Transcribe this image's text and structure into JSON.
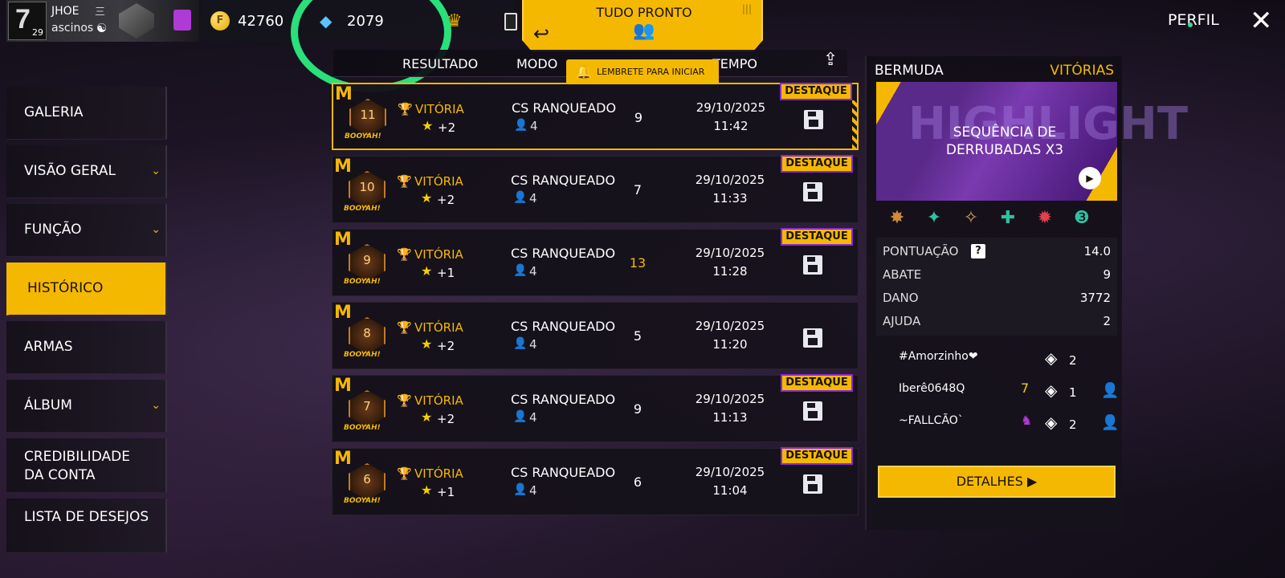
{
  "player": {
    "name": "JHOE",
    "clan": "ascinos",
    "level": "29",
    "glyph": "三"
  },
  "currency": {
    "gold": "42760",
    "diamonds": "2079"
  },
  "ready": {
    "title": "TUDO PRONTO"
  },
  "header": {
    "perfil": "PERFIL"
  },
  "reminder": "LEMBRETE PARA INICIAR",
  "table": {
    "columns": [
      "RESULTADO",
      "MODO",
      "TEMPO"
    ]
  },
  "nav": [
    {
      "label": "GALERIA",
      "chevron": false
    },
    {
      "label": "VISÃO GERAL",
      "chevron": true
    },
    {
      "label": "FUNÇÃO",
      "chevron": true
    },
    {
      "label": "HISTÓRICO",
      "chevron": false,
      "active": true
    },
    {
      "label": "ARMAS",
      "chevron": false
    },
    {
      "label": "ÁLBUM",
      "chevron": true
    },
    {
      "label": "CREDIBILIDADE DA CONTA",
      "chevron": false
    },
    {
      "label": "LISTA DE DESEJOS",
      "chevron": false
    }
  ],
  "matches": [
    {
      "rank": "11",
      "result": "VITÓRIA",
      "points": "+2",
      "mode": "CS RANQUEADO",
      "squad": "4",
      "kills": "9",
      "date": "29/10/2025",
      "time": "11:42",
      "highlight": true,
      "tag": "DESTAQUE",
      "booyah": "BOOYAH!"
    },
    {
      "rank": "10",
      "result": "VITÓRIA",
      "points": "+2",
      "mode": "CS RANQUEADO",
      "squad": "4",
      "kills": "7",
      "date": "29/10/2025",
      "time": "11:33",
      "highlight": true,
      "tag": "DESTAQUE",
      "booyah": "BOOYAH!"
    },
    {
      "rank": "9",
      "result": "VITÓRIA",
      "points": "+1",
      "mode": "CS RANQUEADO",
      "squad": "4",
      "kills": "13",
      "date": "29/10/2025",
      "time": "11:28",
      "highlight": true,
      "tag": "DESTAQUE",
      "booyah": "BOOYAH!"
    },
    {
      "rank": "8",
      "result": "VITÓRIA",
      "points": "+2",
      "mode": "CS RANQUEADO",
      "squad": "4",
      "kills": "5",
      "date": "29/10/2025",
      "time": "11:20",
      "highlight": false,
      "tag": "",
      "booyah": "BOOYAH!"
    },
    {
      "rank": "7",
      "result": "VITÓRIA",
      "points": "+2",
      "mode": "CS RANQUEADO",
      "squad": "4",
      "kills": "9",
      "date": "29/10/2025",
      "time": "11:13",
      "highlight": true,
      "tag": "DESTAQUE",
      "booyah": "BOOYAH!"
    },
    {
      "rank": "6",
      "result": "VITÓRIA",
      "points": "+1",
      "mode": "CS RANQUEADO",
      "squad": "4",
      "kills": "6",
      "date": "29/10/2025",
      "time": "11:04",
      "highlight": true,
      "tag": "DESTAQUE",
      "booyah": "BOOYAH!"
    }
  ],
  "detail": {
    "map": "BERMUDA",
    "result": "VITÓRIAS",
    "highlight_title": "SEQUÊNCIA DE DERRUBADAS X3",
    "highlight_bg": "HIGHLIGHT",
    "stats": [
      {
        "label": "PONTUAÇÃO",
        "value": "14.0"
      },
      {
        "label": "ABATE",
        "value": "9"
      },
      {
        "label": "DANO",
        "value": "3772"
      },
      {
        "label": "AJUDA",
        "value": "2"
      }
    ],
    "players": [
      {
        "name": "#Amorzinho❤",
        "count": "2",
        "addable": false
      },
      {
        "name": "Iberê0648Q",
        "count": "1",
        "addable": true
      },
      {
        "name": "~FALLCÃO`",
        "count": "2",
        "addable": true
      }
    ],
    "details_button": "DETALHES ▶"
  },
  "colors": {
    "accent": "#f5b800",
    "highlight_circle": "#29e07a",
    "tag_border": "#8a2ad6"
  }
}
